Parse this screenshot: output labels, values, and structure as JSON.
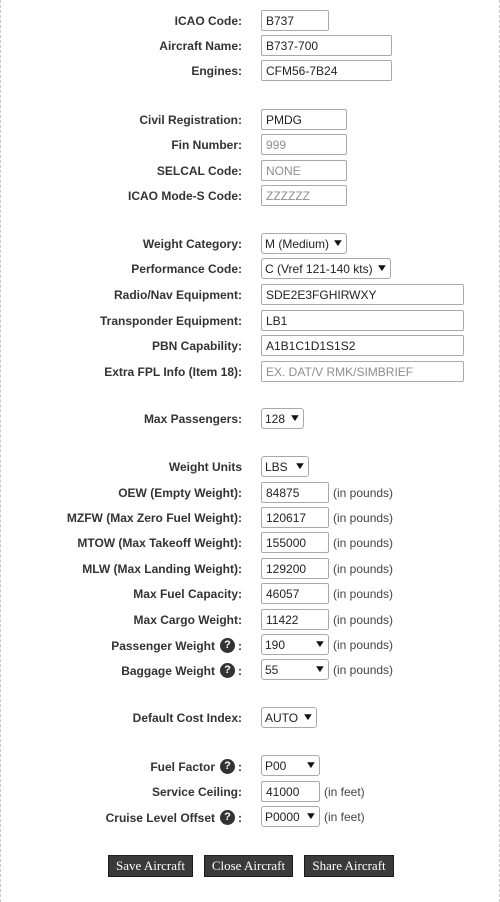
{
  "fields": {
    "icao_code": {
      "label": "ICAO Code:",
      "value": "B737"
    },
    "aircraft_name": {
      "label": "Aircraft Name:",
      "value": "B737-700"
    },
    "engines": {
      "label": "Engines:",
      "value": "CFM56-7B24"
    },
    "civil_registration": {
      "label": "Civil Registration:",
      "value": "PMDG"
    },
    "fin_number": {
      "label": "Fin Number:",
      "placeholder": "999"
    },
    "selcal_code": {
      "label": "SELCAL Code:",
      "placeholder": "NONE"
    },
    "mode_s_code": {
      "label": "ICAO Mode-S Code:",
      "placeholder": "ZZZZZZ"
    },
    "weight_category": {
      "label": "Weight Category:",
      "selected": "M (Medium)"
    },
    "performance_code": {
      "label": "Performance Code:",
      "selected": "C (Vref 121-140 kts)"
    },
    "radio_nav": {
      "label": "Radio/Nav Equipment:",
      "value": "SDE2E3FGHIRWXY"
    },
    "transponder": {
      "label": "Transponder Equipment:",
      "value": "LB1"
    },
    "pbn": {
      "label": "PBN Capability:",
      "value": "A1B1C1D1S1S2"
    },
    "extra_fpl": {
      "label": "Extra FPL Info (Item 18):",
      "placeholder": "EX. DAT/V RMK/SIMBRIEF"
    },
    "max_passengers": {
      "label": "Max Passengers:",
      "selected": "128"
    },
    "weight_units": {
      "label": "Weight Units",
      "selected": "LBS"
    },
    "oew": {
      "label": "OEW (Empty Weight):",
      "value": "84875",
      "unit": "(in pounds)"
    },
    "mzfw": {
      "label": "MZFW (Max Zero Fuel Weight):",
      "value": "120617",
      "unit": "(in pounds)"
    },
    "mtow": {
      "label": "MTOW (Max Takeoff Weight):",
      "value": "155000",
      "unit": "(in pounds)"
    },
    "mlw": {
      "label": "MLW (Max Landing Weight):",
      "value": "129200",
      "unit": "(in pounds)"
    },
    "max_fuel": {
      "label": "Max Fuel Capacity:",
      "value": "46057",
      "unit": "(in pounds)"
    },
    "max_cargo": {
      "label": "Max Cargo Weight:",
      "value": "11422",
      "unit": "(in pounds)"
    },
    "passenger_weight": {
      "label": "Passenger Weight",
      "selected": "190",
      "unit": "(in pounds)"
    },
    "baggage_weight": {
      "label": "Baggage Weight",
      "selected": "55",
      "unit": "(in pounds)"
    },
    "cost_index": {
      "label": "Default Cost Index:",
      "selected": "AUTO"
    },
    "fuel_factor": {
      "label": "Fuel Factor",
      "selected": "P00"
    },
    "service_ceiling": {
      "label": "Service Ceiling:",
      "value": "41000",
      "unit": "(in feet)"
    },
    "cruise_offset": {
      "label": "Cruise Level Offset",
      "selected": "P0000",
      "unit": "(in feet)"
    }
  },
  "help_glyph": "?",
  "colon": ":",
  "dropdown_glyph": "▼",
  "buttons": {
    "save": "Save Aircraft",
    "close": "Close Aircraft",
    "share": "Share Aircraft"
  }
}
